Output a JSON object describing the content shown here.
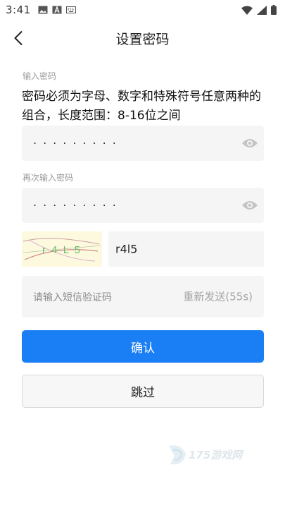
{
  "status_bar": {
    "time": "3:41"
  },
  "header": {
    "title": "设置密码"
  },
  "password": {
    "label": "输入密码",
    "hint": "密码必须为字母、数字和特殊符号任意两种的组合，长度范围：8-16位之间",
    "masked_value": "·········"
  },
  "confirm_password": {
    "label": "再次输入密码",
    "masked_value": "·········"
  },
  "captcha": {
    "image_text": "r 4 L 5",
    "value": "r4l5"
  },
  "sms": {
    "placeholder": "请输入短信验证码",
    "resend_label": "重新发送(55s)"
  },
  "buttons": {
    "confirm": "确认",
    "skip": "跳过"
  },
  "colors": {
    "primary": "#1a7ff5",
    "field_bg": "#f5f5f5",
    "captcha_bg": "#fdf9df"
  },
  "watermark": {
    "text": "175游戏网"
  }
}
